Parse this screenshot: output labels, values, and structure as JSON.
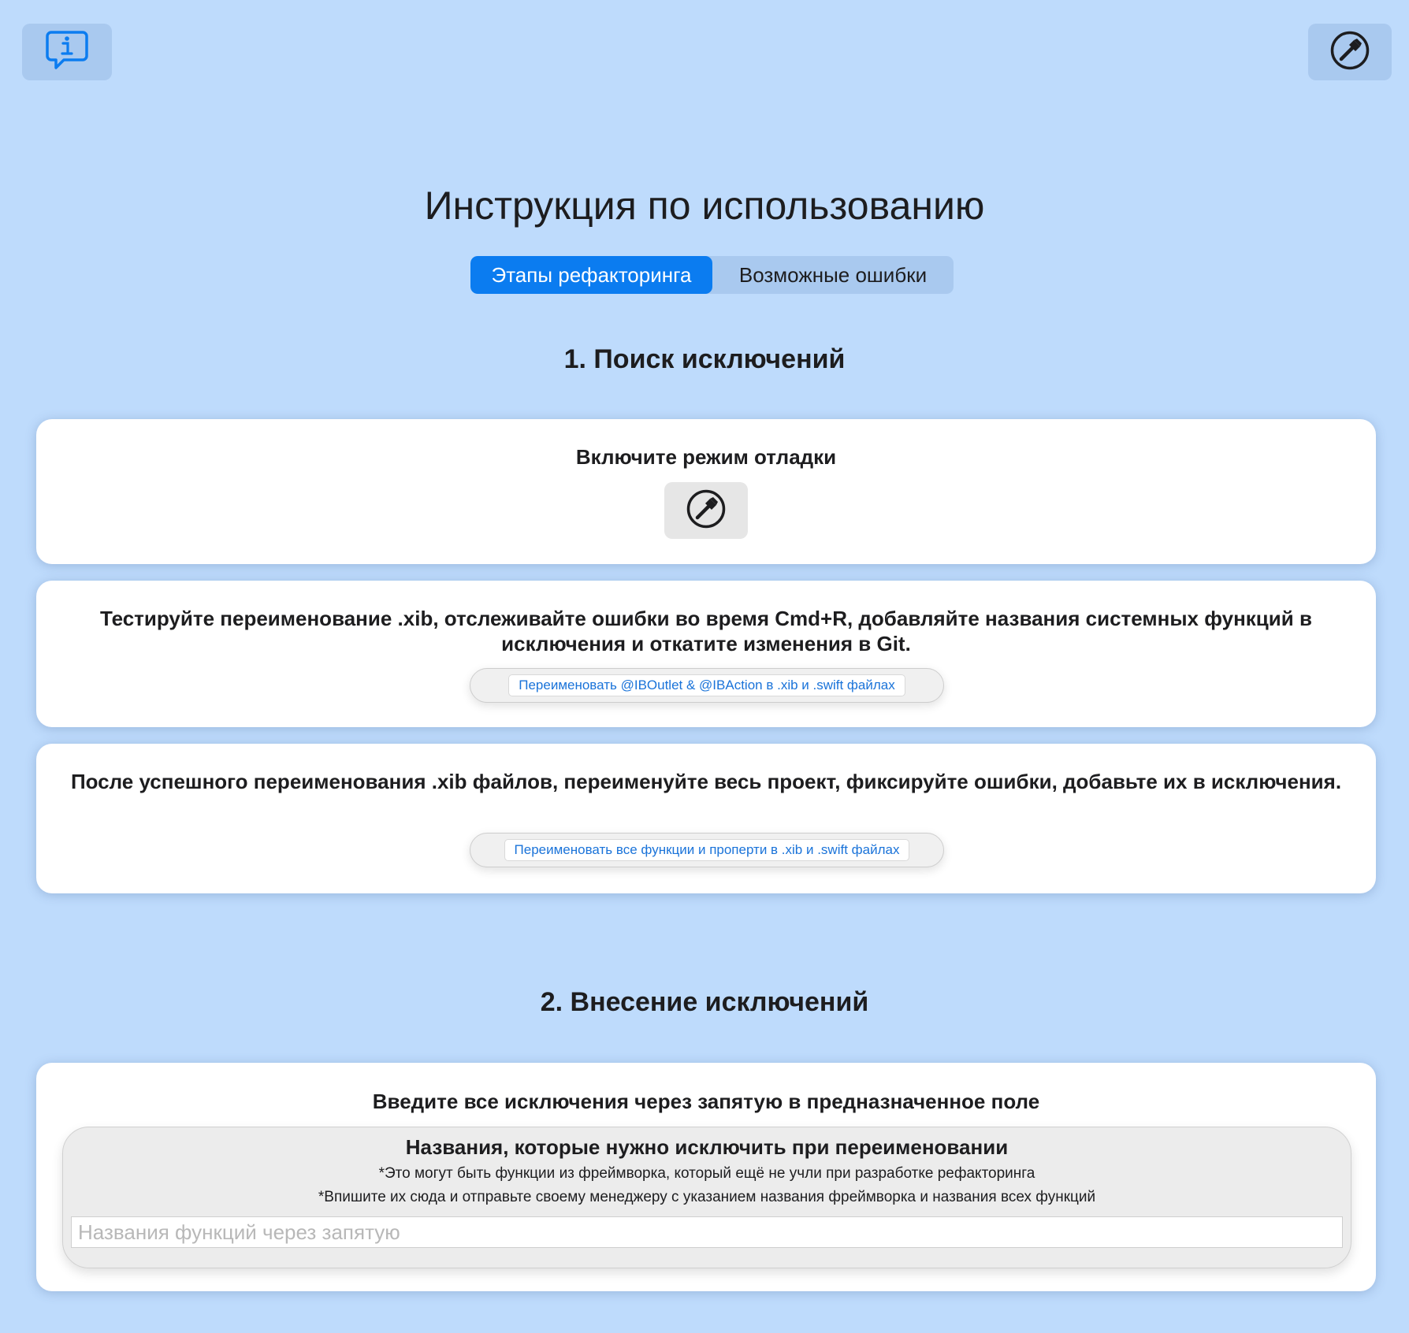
{
  "page": {
    "title": "Инструкция по использованию"
  },
  "top_bar": {
    "info_button_icon": "info-bubble-icon",
    "tool_button_icon": "hammer-circle-icon"
  },
  "tabs": [
    {
      "label": "Этапы рефакторинга",
      "active": true
    },
    {
      "label": "Возможные ошибки",
      "active": false
    }
  ],
  "section1": {
    "title": "1. Поиск исключений",
    "card1": {
      "heading": "Включите режим отладки",
      "button_icon": "hammer-circle-icon"
    },
    "card2": {
      "heading": "Тестируйте переименование .xib, отслеживайте ошибки во время Cmd+R, добавляйте названия системных функций в исключения и откатите изменения в Git.",
      "button_label": "Переименовать @IBOutlet & @IBAction в .xib и .swift файлах"
    },
    "card3": {
      "heading": "После успешного переименования .xib файлов, переименуйте весь проект, фиксируйте ошибки, добавьте их в исключения.",
      "button_label": "Переименовать все функции и проперти в .xib и .swift файлах"
    }
  },
  "section2": {
    "title": "2. Внесение исключений",
    "card": {
      "heading": "Введите все исключения через запятую в предназначенное поле",
      "panel_title": "Названия, которые нужно исключить при переименовании",
      "note_1": "*Это могут быть функции из фреймворка, который ещё не учли при разработке рефакторинга",
      "note_2": "*Впишите их сюда и отправьте своему менеджеру с указанием названия фреймворка и названия всех функций",
      "input_value": "",
      "input_placeholder": "Названия функций через запятую"
    }
  },
  "colors": {
    "background": "#bedbfc",
    "accent": "#0b7cf0",
    "link_text": "#1a73d9"
  }
}
